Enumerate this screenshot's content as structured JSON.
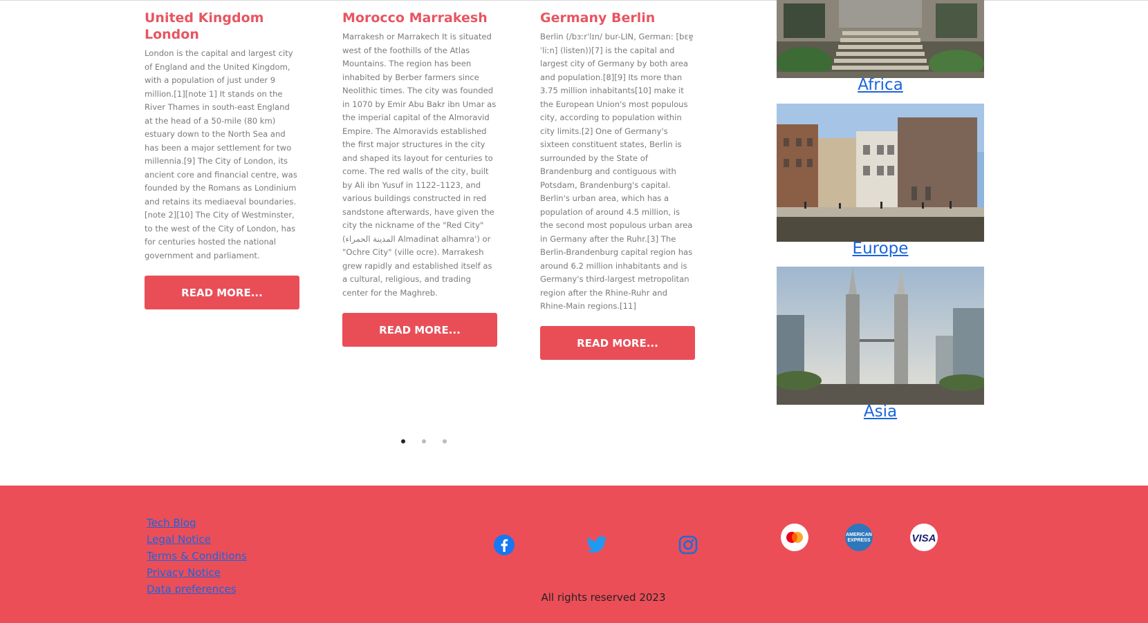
{
  "cards": [
    {
      "title": "United Kingdom London",
      "body": "London is the capital and largest city of England and the United Kingdom, with a population of just under 9 million.[1][note 1] It stands on the River Thames in south-east England at the head of a 50-mile (80 km) estuary down to the North Sea and has been a major settlement for two millennia.[9] The City of London, its ancient core and financial centre, was founded by the Romans as Londinium and retains its mediaeval boundaries.[note 2][10] The City of Westminster, to the west of the City of London, has for centuries hosted the national government and parliament.",
      "button": "Read more..."
    },
    {
      "title": "Morocco Marrakesh",
      "body": "Marrakesh or Marrakech It is situated west of the foothills of the Atlas Mountains. The region has been inhabited by Berber farmers since Neolithic times. The city was founded in 1070 by Emir Abu Bakr ibn Umar as the imperial capital of the Almoravid Empire. The Almoravids established the first major structures in the city and shaped its layout for centuries to come. The red walls of the city, built by Ali ibn Yusuf in 1122–1123, and various buildings constructed in red sandstone afterwards, have given the city the nickname of the \"Red City\" (المدينة الحمراء Almadinat alhamra') or \"Ochre City\" (ville ocre). Marrakesh grew rapidly and established itself as a cultural, religious, and trading center for the Maghreb.",
      "button": "Read more..."
    },
    {
      "title": "Germany Berlin",
      "body": "Berlin (/bɜːrˈlɪn/ bur-LIN, German: [bɛɐ̯ˈliːn] (listen))[7] is the capital and largest city of Germany by both area and population.[8][9] Its more than 3.75 million inhabitants[10] make it the European Union's most populous city, according to population within city limits.[2] One of Germany's sixteen constituent states, Berlin is surrounded by the State of Brandenburg and contiguous with Potsdam, Brandenburg's capital. Berlin's urban area, which has a population of around 4.5 million, is the second most populous urban area in Germany after the Ruhr.[3] The Berlin-Brandenburg capital region has around 6.2 million inhabitants and is Germany's third-largest metropolitan region after the Rhine-Ruhr and Rhine-Main regions.[11]",
      "button": "Read more..."
    }
  ],
  "regions": [
    {
      "label": "Africa",
      "photo": "stone-stairway-building-photo"
    },
    {
      "label": "Europe",
      "photo": "canal-houses-photo"
    },
    {
      "label": "Asia",
      "photo": "twin-towers-photo"
    }
  ],
  "carousel": {
    "total": 3,
    "active_index": 0
  },
  "footer": {
    "links": [
      "Tech Blog",
      "Legal Notice",
      "Terms & Conditions",
      "Privacy Notice",
      "Data preferences"
    ],
    "social": [
      "facebook-icon",
      "twitter-icon",
      "instagram-icon"
    ],
    "payments": [
      {
        "icon": "mastercard-icon"
      },
      {
        "icon": "american-express-icon",
        "text": "AMERICAN EXPRESS"
      },
      {
        "icon": "visa-icon",
        "text": "VISA"
      }
    ],
    "copyright": "All rights reserved 2023"
  },
  "colors": {
    "accent": "#e94e57",
    "footer_background": "#ec4e58",
    "link": "#1a64dc",
    "body_text": "#7a7a7a"
  }
}
